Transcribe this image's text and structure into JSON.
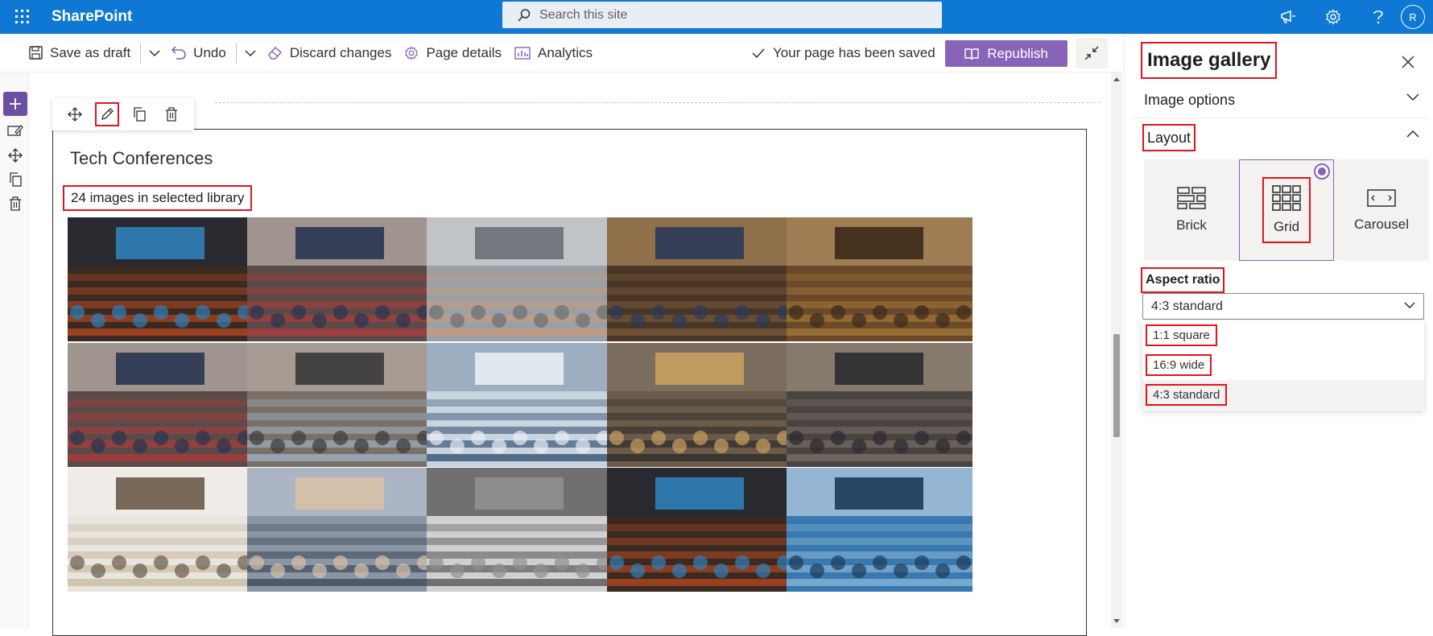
{
  "suite": {
    "app_name": "SharePoint",
    "search_placeholder": "Search this site",
    "avatar_initial": "R"
  },
  "command_bar": {
    "save_draft": "Save as draft",
    "undo": "Undo",
    "discard": "Discard changes",
    "page_details": "Page details",
    "analytics": "Analytics",
    "status": "Your page has been saved",
    "republish": "Republish"
  },
  "gallery": {
    "title": "Tech Conferences",
    "image_count_label": "24 images in selected library",
    "images": [
      "conference-keynote-stage",
      "lecture-hall-audience",
      "team-hands-together",
      "large-conference-hall",
      "auditorium-tiered-seating",
      "lecture-hall-audience",
      "seminar-room-presentation",
      "business-documents-hands",
      "roundtable-discussion",
      "conference-session-audience",
      "woman-presenting-meeting",
      "business-handshake",
      "black-white-auditorium",
      "conference-keynote-stage",
      "glass-building-facade"
    ]
  },
  "property_pane": {
    "title": "Image gallery",
    "image_options": "Image options",
    "layout": "Layout",
    "layout_options": [
      {
        "label": "Brick",
        "icon": "brick-layout-icon",
        "selected": false
      },
      {
        "label": "Grid",
        "icon": "grid-layout-icon",
        "selected": true
      },
      {
        "label": "Carousel",
        "icon": "carousel-layout-icon",
        "selected": false
      }
    ],
    "aspect_ratio_label": "Aspect ratio",
    "aspect_ratio_selected": "4:3 standard",
    "aspect_ratio_options": [
      "1:1 square",
      "16:9 wide",
      "4:3 standard"
    ]
  },
  "colors": {
    "suite_blue": "#0f78d4",
    "accent_purple": "#8764b8",
    "highlight_red": "#e3141b"
  }
}
